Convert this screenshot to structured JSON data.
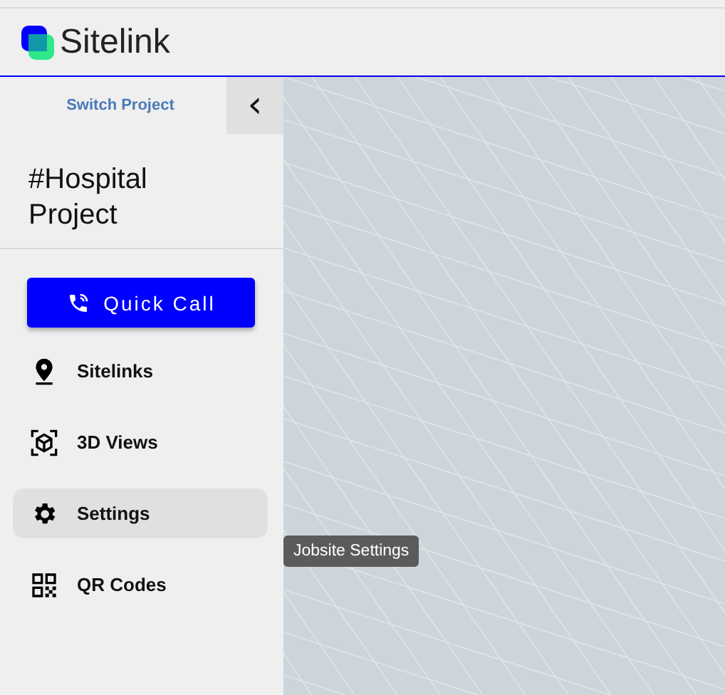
{
  "header": {
    "logo_text": "Sitelink"
  },
  "sidebar": {
    "switch_project": "Switch Project",
    "collapse_icon": "‹",
    "project_title": "#Hospital Project",
    "quick_call": "Quick Call",
    "items": [
      {
        "kind": "pin",
        "label": "Sitelinks",
        "selected": false
      },
      {
        "kind": "cube",
        "label": "3D Views",
        "selected": false
      },
      {
        "kind": "gear",
        "label": "Settings",
        "selected": true
      },
      {
        "kind": "qr",
        "label": "QR Codes",
        "selected": false
      }
    ]
  },
  "tooltip": "Jobsite Settings"
}
